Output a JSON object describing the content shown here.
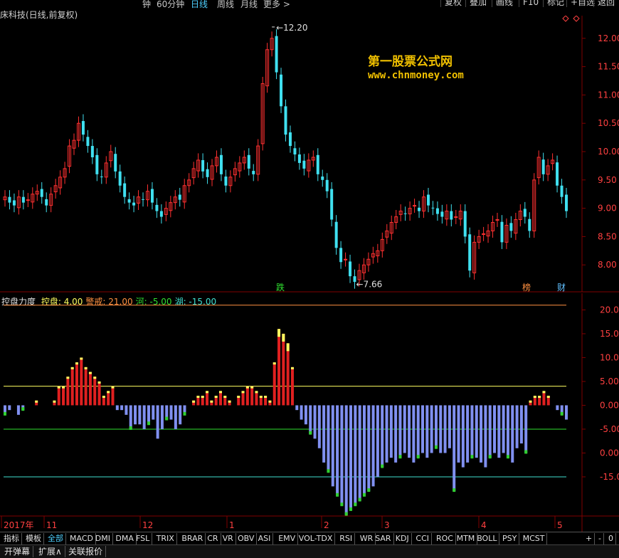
{
  "topbar": {
    "items": [
      "钟",
      "60分钟",
      "日线",
      "周线",
      "月线",
      "更多 >"
    ],
    "active_index": 2,
    "right_buttons": [
      "复权",
      "叠加",
      "画线",
      "F10",
      "标记",
      "+自选",
      "返回"
    ]
  },
  "main_chart": {
    "title": "床科技(日线,前复权)",
    "high_label": "12.20",
    "low_label": "7.66",
    "y_ticks": [
      "12.00",
      "11.50",
      "11.00",
      "10.50",
      "10.00",
      "9.50",
      "9.00",
      "8.50",
      "8.00"
    ],
    "events": [
      {
        "label": "跌",
        "color": "#30e030"
      },
      {
        "label": "榜",
        "color": "#ff9040"
      },
      {
        "label": "财",
        "color": "#60c0ff"
      }
    ]
  },
  "watermark": {
    "line1": "第一股票公式网",
    "line2": "www.chnmoney.com"
  },
  "indicator": {
    "name": "控盘力度",
    "params": [
      {
        "label": "控盘:",
        "value": "4.00",
        "color": "#ffff60"
      },
      {
        "label": "警戒:",
        "value": "21.00",
        "color": "#ff9040"
      },
      {
        "label": "河:",
        "value": "-5.00",
        "color": "#30e030"
      },
      {
        "label": "湖:",
        "value": "-15.00",
        "color": "#40e0d0"
      }
    ],
    "y_ticks": [
      "20.00",
      "15.00",
      "10.00",
      "5.00",
      "0.00",
      "-5.00",
      "0.00",
      "-15.00"
    ]
  },
  "x_axis": {
    "labels": [
      "2017年",
      "11",
      "12",
      "1",
      "2",
      "3",
      "4",
      "5"
    ]
  },
  "tabs": {
    "items": [
      "指标",
      "模板",
      "全部",
      "MACD",
      "DMI",
      "DMA",
      "FSL",
      "TRIX",
      "BRAR",
      "CR",
      "VR",
      "OBV",
      "ASI",
      "EMV",
      "VOL-TDX",
      "RSI",
      "WR",
      "SAR",
      "KDJ",
      "CCI",
      "ROC",
      "MTM",
      "BOLL",
      "PSY",
      "MCST"
    ],
    "active": "全部",
    "right": [
      "+",
      "-",
      "0"
    ]
  },
  "bottombar": {
    "items": [
      "开弹幕",
      "扩展∧",
      "关联报价"
    ]
  },
  "colors": {
    "up": "#ff3030",
    "down": "#40e0f0",
    "grid": "#800000",
    "neg_bar": "#8090f0",
    "pos_bar": "#e02020",
    "pos_cap": "#ffff60",
    "neg_cap": "#30d030"
  },
  "chart_data": [
    {
      "type": "candlestick",
      "title": "床科技(日线,前复权)",
      "ylim": [
        7.5,
        12.4
      ],
      "annotations": [
        {
          "text": "12.20",
          "type": "high"
        },
        {
          "text": "7.66",
          "type": "low"
        }
      ],
      "close": [
        9.2,
        9.1,
        9.05,
        9.2,
        9.1,
        9.15,
        9.25,
        9.3,
        9.2,
        9.05,
        9.25,
        9.4,
        9.55,
        9.7,
        10.1,
        10.2,
        10.5,
        10.3,
        10.1,
        9.9,
        9.6,
        9.55,
        9.8,
        10.0,
        9.65,
        9.4,
        9.2,
        9.1,
        9.05,
        9.2,
        9.15,
        9.3,
        9.1,
        8.95,
        8.85,
        9.0,
        9.1,
        9.2,
        9.15,
        9.4,
        9.5,
        9.7,
        9.85,
        9.65,
        9.55,
        9.75,
        9.9,
        9.6,
        9.4,
        9.55,
        9.7,
        9.8,
        9.9,
        9.7,
        9.6,
        10.1,
        11.2,
        11.8,
        12.0,
        11.4,
        10.8,
        10.3,
        10.1,
        9.95,
        9.8,
        9.7,
        9.85,
        9.9,
        9.6,
        9.5,
        9.3,
        8.8,
        8.3,
        8.05,
        8.1,
        7.8,
        7.7,
        7.9,
        8.0,
        8.1,
        8.2,
        8.25,
        8.45,
        8.6,
        8.75,
        8.85,
        8.95,
        8.9,
        9.0,
        9.05,
        8.95,
        9.2,
        9.05,
        9.0,
        8.9,
        8.85,
        8.95,
        8.8,
        8.85,
        8.95,
        8.5,
        7.9,
        8.4,
        8.5,
        8.55,
        8.6,
        8.75,
        8.8,
        8.4,
        8.7,
        8.6,
        8.8,
        8.95,
        8.85,
        8.6,
        9.5,
        9.9,
        9.6,
        9.75,
        9.85,
        9.4,
        9.2,
        8.95
      ]
    },
    {
      "type": "bar",
      "title": "控盘力度",
      "ylim": [
        -25,
        22
      ],
      "reference_lines": {
        "控盘": 4,
        "警戒": 21,
        "河": -5,
        "湖": -15
      },
      "values": [
        -2,
        -1,
        0,
        -2,
        -1,
        0,
        0,
        1,
        0,
        0,
        0,
        1,
        4,
        4,
        6,
        8,
        9,
        10,
        8,
        7,
        6,
        5,
        2,
        3,
        4,
        -1,
        -1,
        -2,
        -5,
        -4,
        -4,
        -5,
        -4,
        -3,
        -7,
        -5,
        -3,
        -3,
        -5,
        -4,
        -2,
        0,
        1,
        2,
        2,
        3,
        1,
        2,
        3,
        2,
        1,
        0,
        2,
        3,
        4,
        4,
        3,
        2,
        2,
        1,
        9,
        16,
        15,
        13,
        8,
        -1,
        -3,
        -4,
        -6,
        -7,
        -9,
        -12,
        -14,
        -17,
        -19,
        -21,
        -23,
        -22,
        -21,
        -20,
        -19,
        -18,
        -17,
        -15,
        -13,
        -12,
        -11,
        -12,
        -11,
        -10,
        -11,
        -12,
        -11,
        -10,
        -11,
        -10,
        -9,
        -10,
        -10,
        -9,
        -18,
        -12,
        -13,
        -12,
        -11,
        -11,
        -12,
        -13,
        -11,
        -10,
        -11,
        -10,
        -11,
        -12,
        -9,
        -8,
        -10,
        1,
        2,
        2,
        3,
        2,
        0,
        -1,
        -2,
        -3
      ]
    }
  ]
}
